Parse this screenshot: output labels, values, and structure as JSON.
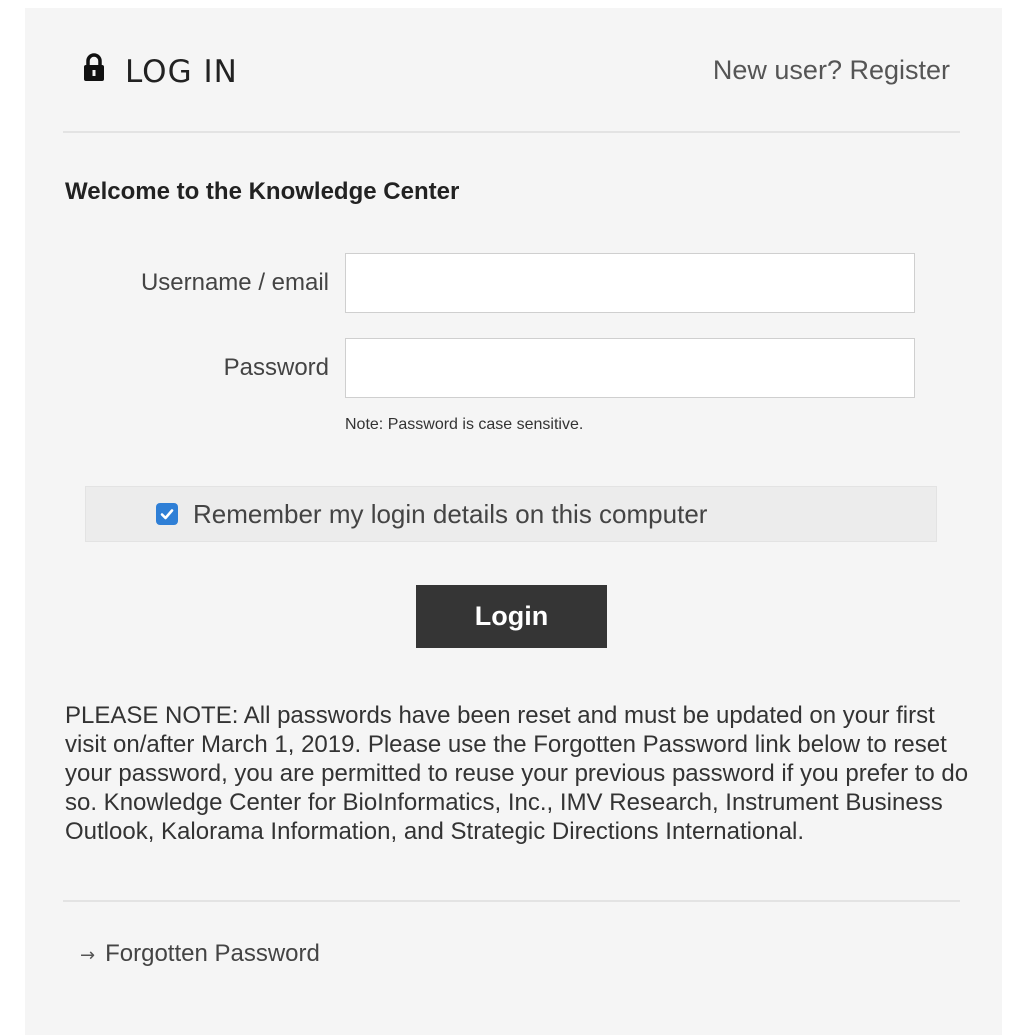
{
  "header": {
    "title": "LOG IN",
    "lock_icon": "lock-icon",
    "register_link": "New user? Register"
  },
  "form": {
    "welcome": "Welcome to the Knowledge Center",
    "username": {
      "label": "Username / email",
      "value": "",
      "placeholder": ""
    },
    "password": {
      "label": "Password",
      "value": "",
      "placeholder": "",
      "note": "Note: Password is case sensitive."
    },
    "remember": {
      "label": "Remember my login details on this computer",
      "checked": true
    },
    "login_button": "Login"
  },
  "notice": "PLEASE NOTE: All passwords have been reset and must be updated on your first visit on/after March 1, 2019. Please use the Forgotten Password link below to reset your password, you are permitted to reuse your previous password if you prefer to do so. Knowledge Center for BioInformatics, Inc., IMV Research, Instrument Business Outlook, Kalorama Information, and Strategic Directions International.",
  "footer": {
    "arrow": "→",
    "forgot_link": "Forgotten Password"
  },
  "colors": {
    "panel_background": "#f5f5f5",
    "button_background": "#353535",
    "checkbox_accent": "#2f7fd6"
  }
}
